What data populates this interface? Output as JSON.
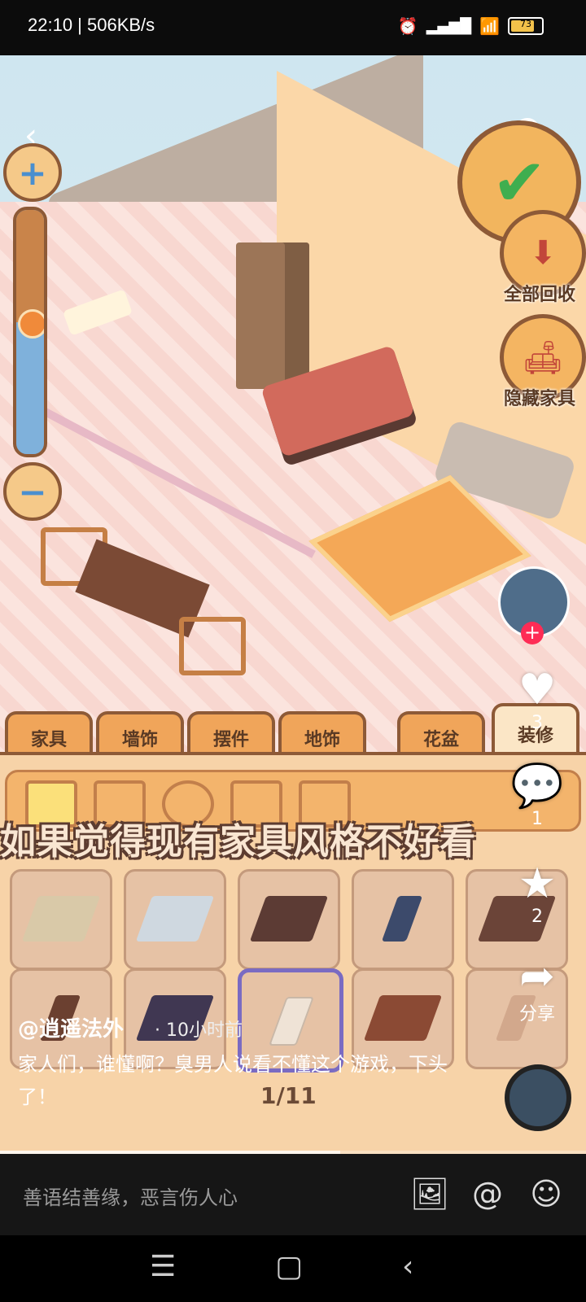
{
  "status_bar": {
    "time": "22:10 | 506KB/s",
    "battery": "73"
  },
  "game": {
    "side_buttons": {
      "recycle_all": "全部回收",
      "hide_furniture": "隐藏家具"
    },
    "tabs": [
      "家具",
      "墙饰",
      "摆件",
      "地饰",
      "花盆",
      "装修"
    ],
    "active_tab": "装修",
    "subtitle": "如果觉得现有家具风格不好看",
    "tile_colors": [
      "#d9c9a8",
      "#cfd8e0",
      "#5c3b34",
      "#3c4a6b",
      "#6b4438",
      "#6b4030",
      "#403752",
      "#efe3d6",
      "#8b4a34",
      "#d2a88c"
    ]
  },
  "video": {
    "author": "@逍遥法外",
    "time_ago": "· 10小时前",
    "description": "家人们，谁懂啊？臭男人说看不懂这个游戏，下头了！",
    "page_indicator": "1/11",
    "likes": "3",
    "comments": "1",
    "favorites": "2",
    "share_label": "分享",
    "progress": 0.58
  },
  "comment_bar": {
    "placeholder": "善语结善缘，恶言伤人心"
  }
}
